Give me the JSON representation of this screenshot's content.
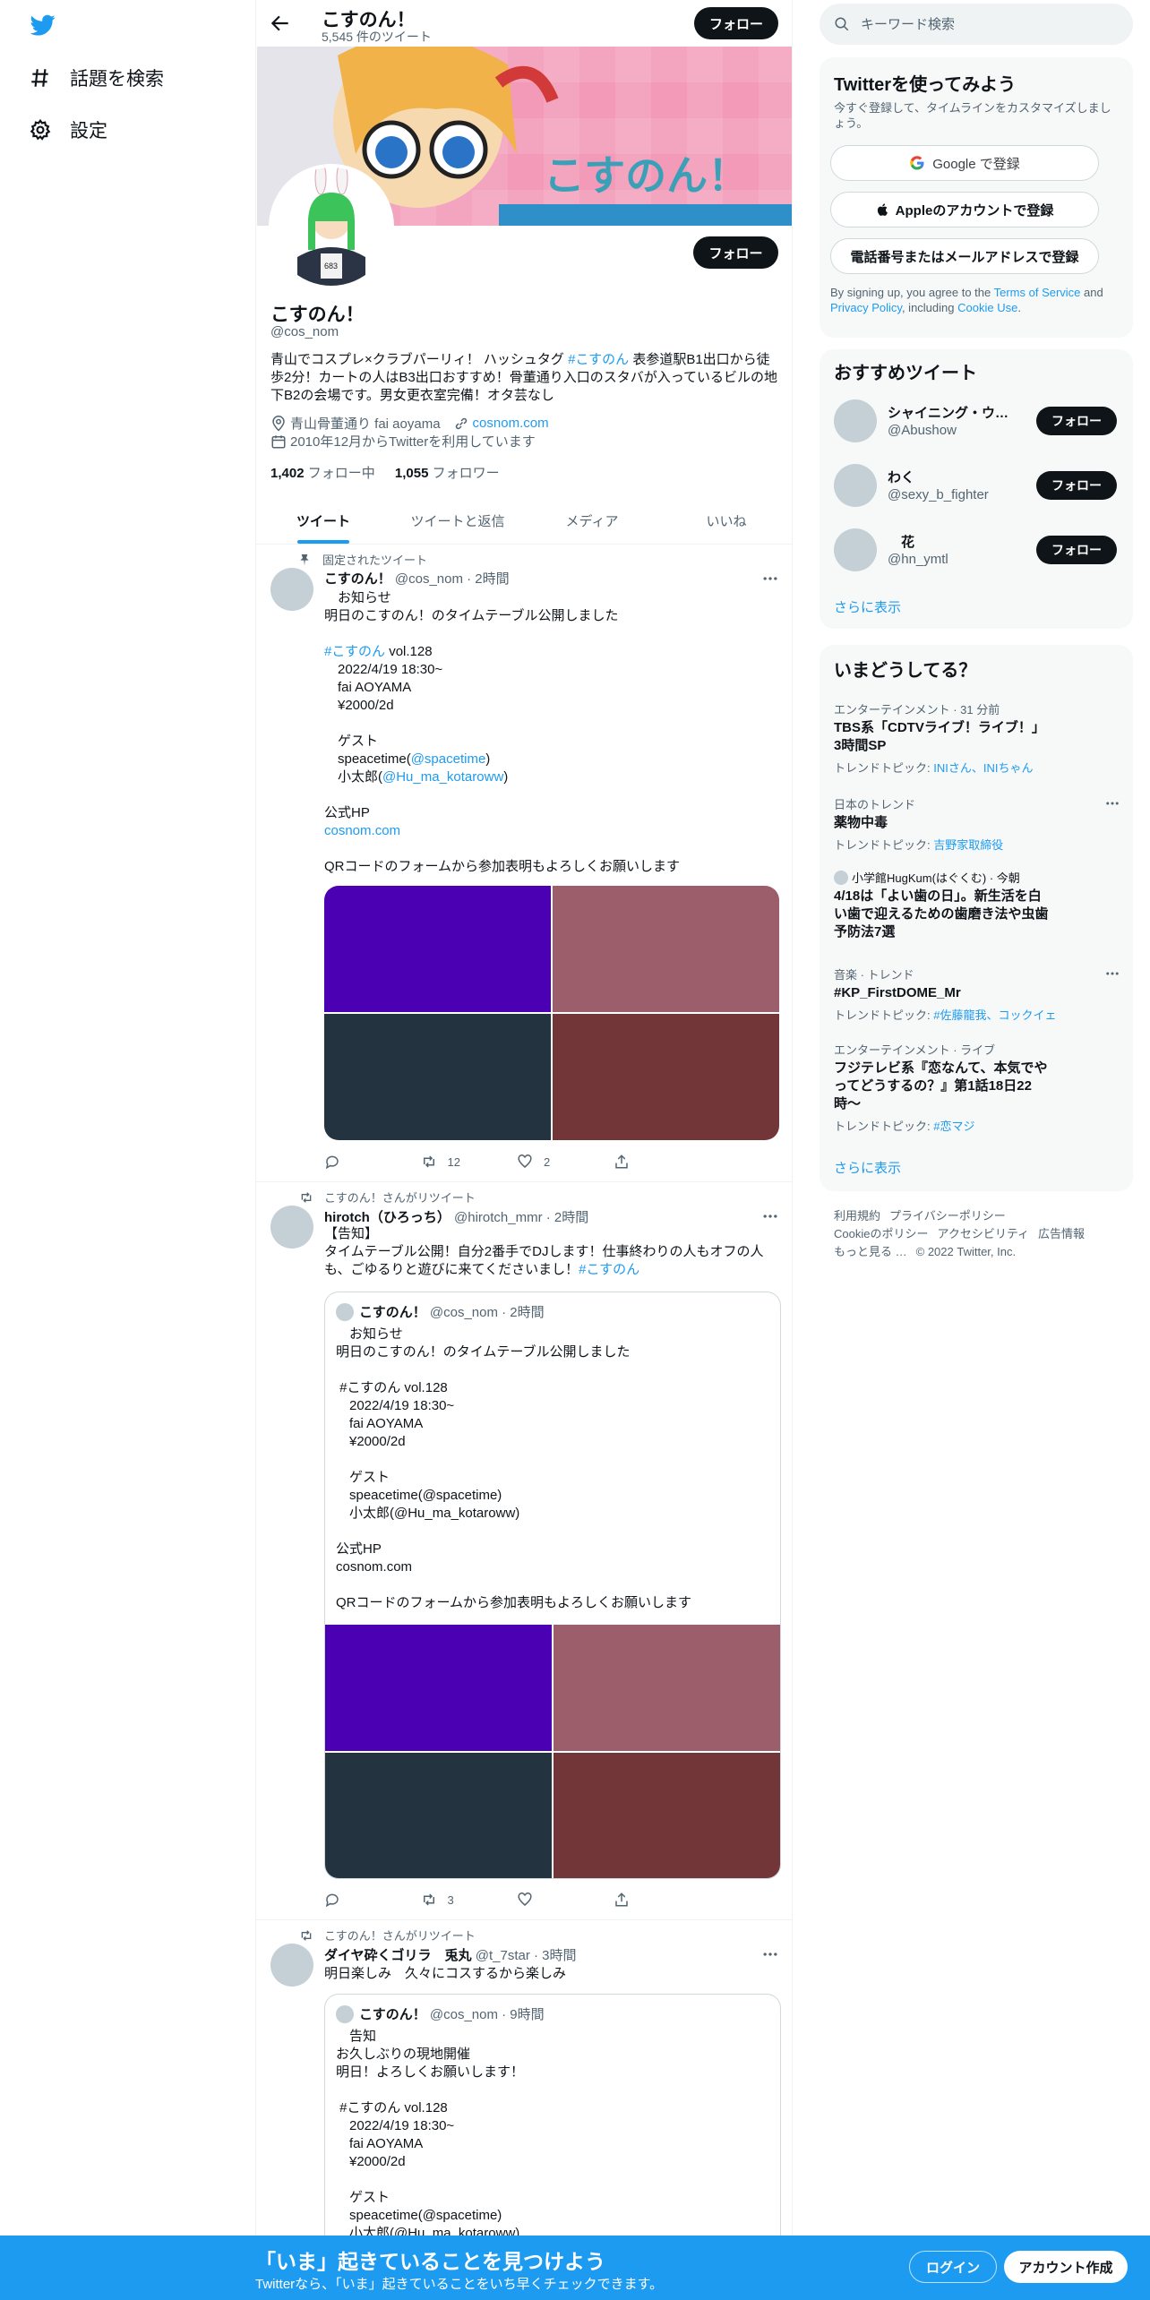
{
  "nav": {
    "explore_label": "話題を検索",
    "settings_label": "設定"
  },
  "profile": {
    "top_name": "こすのん！",
    "tweet_count": "5,545 件のツイート",
    "follow_label": "フォロー",
    "banner_text": "こすのん！",
    "avatar_tag": "683",
    "name": "こすのん！",
    "handle": "@cos_nom",
    "bio_1": "青山でコスプレ×クラブパーリィ！ ハッシュタグ ",
    "bio_hashtag": "#こすのん",
    "bio_2": " 表参道駅B1出口から徒歩2分！カートの人はB3出口おすすめ！骨董通り入口のスタバが入っているビルの地下B2の会場です。男女更衣室完備！オタ芸なし",
    "location": "青山骨董通り fai aoyama",
    "website": "cosnom.com",
    "joined": "2010年12月からTwitterを利用しています",
    "following_count": "1,402",
    "following_label": "フォロー中",
    "followers_count": "1,055",
    "followers_label": "フォロワー"
  },
  "tabs": [
    "ツイート",
    "ツイートと返信",
    "メディア",
    "いいね"
  ],
  "tweets": {
    "t1": {
      "context": "固定されたツイート",
      "name": "こすのん！",
      "handle": "@cos_nom · 2時間",
      "body_a": "　お知らせ\n明日のこすのん！のタイムテーブル公開しました\n\n",
      "hashtag": "#こすのん",
      "body_b": " vol.128\n　2022/4/19 18:30~\n　fai AOYAMA\n　¥2000/2d\n\n　ゲスト\n　speacetime(",
      "mention1": "@spacetime",
      "body_c": ")\n　小太郎(",
      "mention2": "@Hu_ma_kotaroww",
      "body_d": ")\n\n公式HP\n",
      "link": "cosnom.com",
      "body_e": "\n\nQRコードのフォームから参加表明もよろしくお願いします",
      "retweets": "12",
      "likes": "2"
    },
    "t2": {
      "context": "こすのん！さんがリツイート",
      "name": "hirotch（ひろっち）",
      "handle": "@hirotch_mmr · 2時間",
      "body": "【告知】\nタイムテーブル公開！自分2番手でDJします！仕事終わりの人もオフの人も、ごゆるりと遊びに来てくださいまし！",
      "hashtag": "#こすのん",
      "quote_name": "こすのん！",
      "quote_handle": "@cos_nom · 2時間",
      "quote_body": "　お知らせ\n明日のこすのん！のタイムテーブル公開しました\n\n #こすのん vol.128\n　2022/4/19 18:30~\n　fai AOYAMA\n　¥2000/2d\n\n　ゲスト\n　speacetime(@spacetime)\n　小太郎(@Hu_ma_kotaroww)\n\n公式HP\ncosnom.com\n\nQRコードのフォームから参加表明もよろしくお願いします",
      "retweets": "3"
    },
    "t3": {
      "context": "こすのん！さんがリツイート",
      "name": "ダイヤ砕くゴリラ　兎丸",
      "handle": "@t_7star · 3時間",
      "body": "明日楽しみ　久々にコスするから楽しみ",
      "quote_name": "こすのん！",
      "quote_handle": "@cos_nom · 9時間",
      "quote_body": "　告知\nお久しぶりの現地開催\n明日！よろしくお願いします！\n\n #こすのん vol.128\n　2022/4/19 18:30~\n　fai AOYAMA\n　¥2000/2d\n\n　ゲスト\n　speacetime(@spacetime)\n　小太郎(@Hu_ma_kotaroww)"
    }
  },
  "media_colors": [
    "#4b00b4",
    "#9c5e6a",
    "#243340",
    "#723538"
  ],
  "right": {
    "search_placeholder": "キーワード検索",
    "signup_title": "Twitterを使ってみよう",
    "signup_sub": "今すぐ登録して、タイムラインをカスタマイズしましょう。",
    "google_btn": "Google で登録",
    "apple_btn": "Appleのアカウントで登録",
    "phone_btn": "電話番号またはメールアドレスで登録",
    "terms_1": "By signing up, you agree to the ",
    "terms_link1": "Terms of Service",
    "terms_2": " and ",
    "terms_link2": "Privacy Policy",
    "terms_3": ", including ",
    "terms_link3": "Cookie Use",
    "terms_4": ".",
    "rec_title": "おすすめツイート",
    "recs": [
      {
        "name": "シャイニング・ウィザード",
        "handle": "@Abushow"
      },
      {
        "name": "わく",
        "handle": "@sexy_b_fighter"
      },
      {
        "name": "　花",
        "handle": "@hn_ymtl"
      }
    ],
    "show_more": "さらに表示",
    "trends_title": "いまどうしてる？",
    "trends": [
      {
        "cat": "エンターテインメント · 31 分前",
        "title": "TBS系「CDTVライブ！ライブ！」3時間SP",
        "sub": "トレンドトピック: ",
        "tags": "INIさん、INIちゃん"
      },
      {
        "cat": "日本のトレンド",
        "title": "薬物中毒",
        "sub": "トレンドトピック: ",
        "tags": "吉野家取締役"
      },
      {
        "cat": "小学館HugKum(はぐくむ) · 今朝",
        "title": "4/18は「よい歯の日」。新生活を白い歯で迎えるための歯磨き法や虫歯予防法7選",
        "sub": "",
        "tags": ""
      },
      {
        "cat": "音楽 · トレンド",
        "title": "#KP_FirstDOME_Mr",
        "sub": "トレンドトピック: ",
        "tags": "#佐藤龍我、コックイェ"
      },
      {
        "cat": "エンターテインメント · ライブ",
        "title": "フジテレビ系『恋なんて、本気でやってどうするの？』第1話18日22時〜",
        "sub": "トレンドトピック: ",
        "tags": "#恋マジ"
      }
    ],
    "footer_links": [
      "利用規約",
      "プライバシーポリシー",
      "Cookieのポリシー",
      "アクセシビリティ",
      "広告情報",
      "もっと見る …",
      "© 2022 Twitter, Inc."
    ]
  },
  "bottom": {
    "title": "「いま」起きていることを見つけよう",
    "sub": "Twitterなら、「いま」起きていることをいち早くチェックできます。",
    "login": "ログイン",
    "signup": "アカウント作成"
  }
}
